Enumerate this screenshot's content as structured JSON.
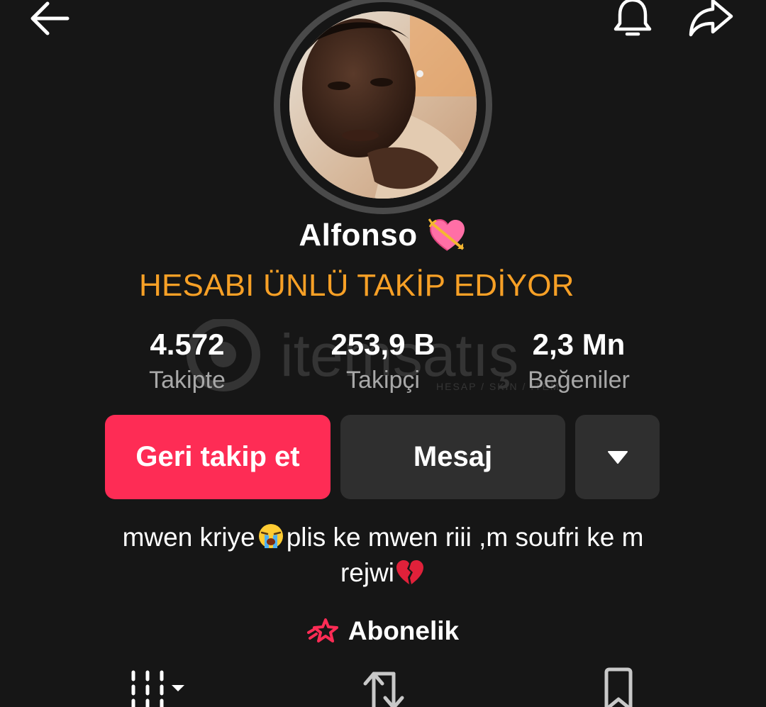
{
  "header": {
    "back_icon": "arrow-left-icon",
    "notification_icon": "bell-icon",
    "share_icon": "share-icon"
  },
  "profile": {
    "avatar": "profile-photo",
    "username": "Alfonso",
    "username_emoji": "heart-with-arrow-emoji",
    "tagline": "HESABI ÜNLÜ TAKİP EDİYOR"
  },
  "stats": [
    {
      "value": "4.572",
      "label": "Takipte"
    },
    {
      "value": "253,9 B",
      "label": "Takipçi"
    },
    {
      "value": "2,3 Mn",
      "label": "Beğeniler"
    }
  ],
  "watermark": {
    "brand": "itemsatış",
    "sub": "HESAP / SKIN / ITEM"
  },
  "actions": {
    "follow_back_label": "Geri takip et",
    "message_label": "Mesaj",
    "more_icon": "caret-down-icon"
  },
  "bio": {
    "line1_part1": "mwen kriye",
    "line1_emoji": "loudly-crying-face-emoji",
    "line1_part2": "plis ke mwen riii ,m soufri ke m",
    "line2_part1": "rejwi",
    "line2_emoji": "broken-heart-emoji"
  },
  "subscription": {
    "label": "Abonelik",
    "icon": "shooting-star-icon"
  },
  "tabs": [
    {
      "icon": "grid-videos-icon"
    },
    {
      "icon": "repost-icon"
    },
    {
      "icon": "bookmark-icon"
    }
  ],
  "colors": {
    "background": "#161616",
    "accent_red": "#fe2c55",
    "tagline_orange": "#f7a026",
    "button_gray": "#2f2f2f",
    "label_gray": "#a8a8a8"
  }
}
